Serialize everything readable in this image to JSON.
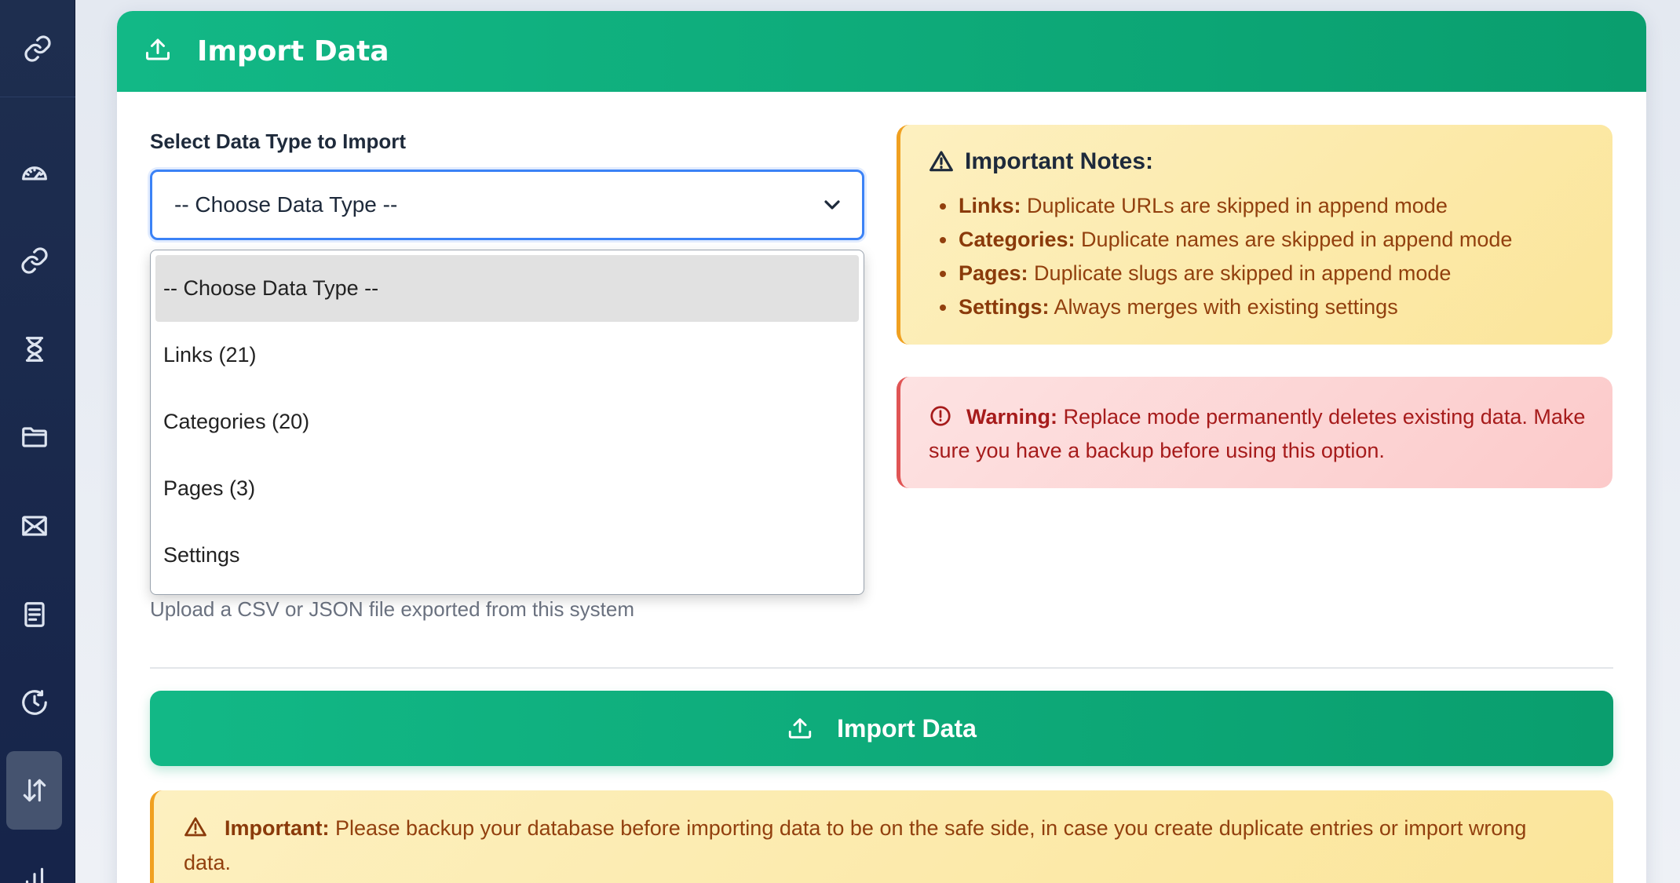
{
  "sidebar": {
    "logo_icon": "link-icon",
    "items": [
      {
        "icon": "dashboard-gauge-icon",
        "active": false
      },
      {
        "icon": "link-icon",
        "active": false
      },
      {
        "icon": "hourglass-icon",
        "active": false
      },
      {
        "icon": "folder-icon",
        "active": false
      },
      {
        "icon": "envelope-icon",
        "active": false
      },
      {
        "icon": "document-icon",
        "active": false
      },
      {
        "icon": "clock-history-icon",
        "active": false
      },
      {
        "icon": "arrows-up-down-icon",
        "active": true
      },
      {
        "icon": "bar-chart-icon",
        "active": false
      }
    ]
  },
  "header": {
    "icon": "upload-icon",
    "title": "Import Data"
  },
  "form": {
    "type_label": "Select Data Type to Import",
    "select_value": "-- Choose Data Type --",
    "options": [
      {
        "label": "-- Choose Data Type --",
        "selected": true
      },
      {
        "label": "Links (21)",
        "selected": false
      },
      {
        "label": "Categories (20)",
        "selected": false
      },
      {
        "label": "Pages (3)",
        "selected": false
      },
      {
        "label": "Settings",
        "selected": false
      }
    ],
    "file_hint": "Upload a CSV or JSON file exported from this system"
  },
  "notes": {
    "title": "Important Notes:",
    "items": [
      {
        "key": "Links:",
        "text": " Duplicate URLs are skipped in append mode"
      },
      {
        "key": "Categories:",
        "text": " Duplicate names are skipped in append mode"
      },
      {
        "key": "Pages:",
        "text": " Duplicate slugs are skipped in append mode"
      },
      {
        "key": "Settings:",
        "text": " Always merges with existing settings"
      }
    ]
  },
  "warning": {
    "key": "Warning:",
    "text": " Replace mode permanently deletes existing data. Make sure you have a backup before using this option."
  },
  "import_button": {
    "label": "Import Data"
  },
  "important": {
    "key": "Important:",
    "text": " Please backup your database before importing data to be on the safe side, in case you create duplicate entries or import wrong data."
  },
  "colors": {
    "primary_green": "#12b886",
    "sidebar_bg": "#1e2e4f",
    "focus_blue": "#3b82f6",
    "note_text": "#92400e",
    "warning_text": "#a61b1b"
  }
}
